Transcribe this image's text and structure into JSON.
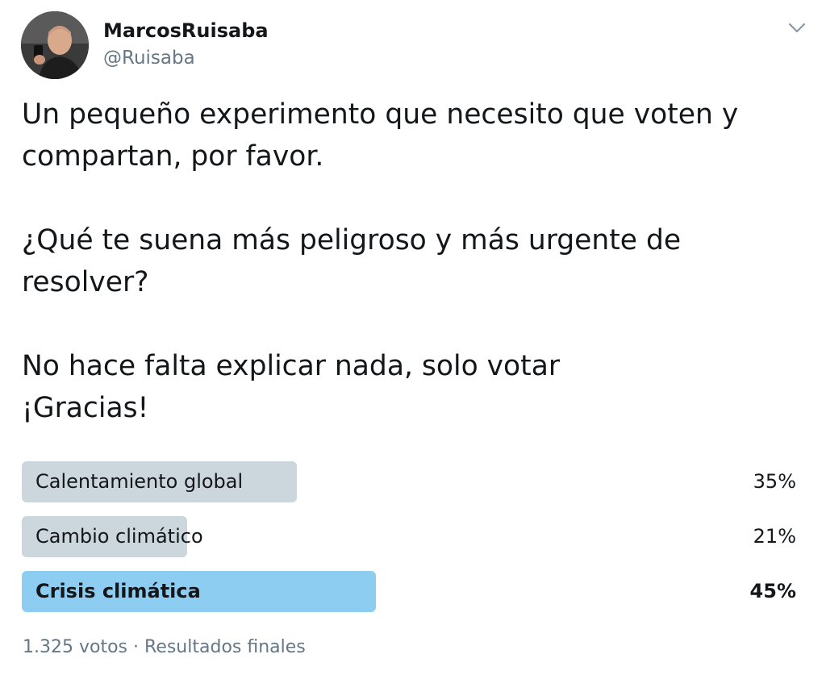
{
  "user": {
    "name": "MarcosRuisaba",
    "handle": "@Ruisaba"
  },
  "tweet": {
    "paragraphs": [
      "Un pequeño experimento que necesito que voten y\ncompartan, por favor.",
      "¿Qué te suena más peligroso y más urgente de\nresolver?",
      "No hace falta explicar nada, solo votar\n¡Gracias!"
    ]
  },
  "poll": {
    "options": [
      {
        "label": "Calentamiento global",
        "percent": "35%",
        "fraction": 0.35,
        "winner": false
      },
      {
        "label": "Cambio climático",
        "percent": "21%",
        "fraction": 0.21,
        "winner": false
      },
      {
        "label": "Crisis climática",
        "percent": "45%",
        "fraction": 0.45,
        "winner": true
      }
    ],
    "votes": "1.325 votos",
    "separator": "·",
    "status": "Resultados finales"
  },
  "colors": {
    "bar": "#ccd6dd",
    "bar_winner": "#8ecdf2",
    "secondary_text": "#657786"
  },
  "icons": {
    "menu": "chevron-down-icon"
  }
}
